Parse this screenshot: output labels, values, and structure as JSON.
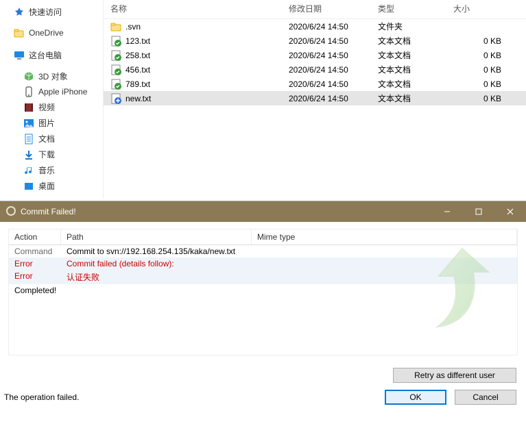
{
  "sidebar": [
    {
      "id": "quickaccess",
      "label": "快速访问",
      "color": "#2b7bd6",
      "glyph": "star"
    },
    {
      "id": "onedrive",
      "label": "OneDrive",
      "color": "#0078d4",
      "glyph": "cloud-folder"
    },
    {
      "id": "thispc",
      "label": "这台电脑",
      "color": "#1e88e5",
      "glyph": "monitor"
    },
    {
      "id": "3dobjects",
      "label": "3D 对象",
      "color": "#4caf50",
      "glyph": "cube",
      "indent": true
    },
    {
      "id": "iphone",
      "label": "Apple iPhone",
      "color": "#555",
      "glyph": "phone",
      "indent": true
    },
    {
      "id": "videos",
      "label": "视频",
      "color": "#8b2c2c",
      "glyph": "film",
      "indent": true
    },
    {
      "id": "pictures",
      "label": "图片",
      "color": "#1e88e5",
      "glyph": "image",
      "indent": true
    },
    {
      "id": "documents",
      "label": "文档",
      "color": "#1e88e5",
      "glyph": "doc",
      "indent": true
    },
    {
      "id": "downloads",
      "label": "下载",
      "color": "#1976d2",
      "glyph": "down",
      "indent": true
    },
    {
      "id": "music",
      "label": "音乐",
      "color": "#1e88e5",
      "glyph": "note",
      "indent": true
    },
    {
      "id": "desktop",
      "label": "桌面",
      "color": "#1e88e5",
      "glyph": "square",
      "indent": true
    }
  ],
  "columns": {
    "name": "名称",
    "date": "修改日期",
    "type": "类型",
    "size": "大小"
  },
  "files": [
    {
      "icon": "folder",
      "name": ".svn",
      "date": "2020/6/24 14:50",
      "type": "文件夹",
      "size": ""
    },
    {
      "icon": "svn-ok",
      "name": "123.txt",
      "date": "2020/6/24 14:50",
      "type": "文本文档",
      "size": "0 KB"
    },
    {
      "icon": "svn-ok",
      "name": "258.txt",
      "date": "2020/6/24 14:50",
      "type": "文本文档",
      "size": "0 KB"
    },
    {
      "icon": "svn-ok",
      "name": "456.txt",
      "date": "2020/6/24 14:50",
      "type": "文本文档",
      "size": "0 KB"
    },
    {
      "icon": "svn-ok",
      "name": "789.txt",
      "date": "2020/6/24 14:50",
      "type": "文本文档",
      "size": "0 KB"
    },
    {
      "icon": "svn-add",
      "name": "new.txt",
      "date": "2020/6/24 14:50",
      "type": "文本文档",
      "size": "0 KB",
      "selected": true
    }
  ],
  "dialog": {
    "title": "Commit Failed!",
    "head": {
      "action": "Action",
      "path": "Path",
      "mime": "Mime type"
    },
    "rows": [
      {
        "action": "Command",
        "path": "Commit to svn://192.168.254.135/kaka/new.txt",
        "cls": ""
      },
      {
        "action": "Error",
        "path": "Commit failed (details follow):",
        "cls": "err"
      },
      {
        "action": "Error",
        "path": "认证失败",
        "cls": "err"
      },
      {
        "action": "Completed!",
        "path": "",
        "cls": ""
      }
    ],
    "retry": "Retry as different user",
    "status": "The operation failed.",
    "ok": "OK",
    "cancel": "Cancel"
  }
}
